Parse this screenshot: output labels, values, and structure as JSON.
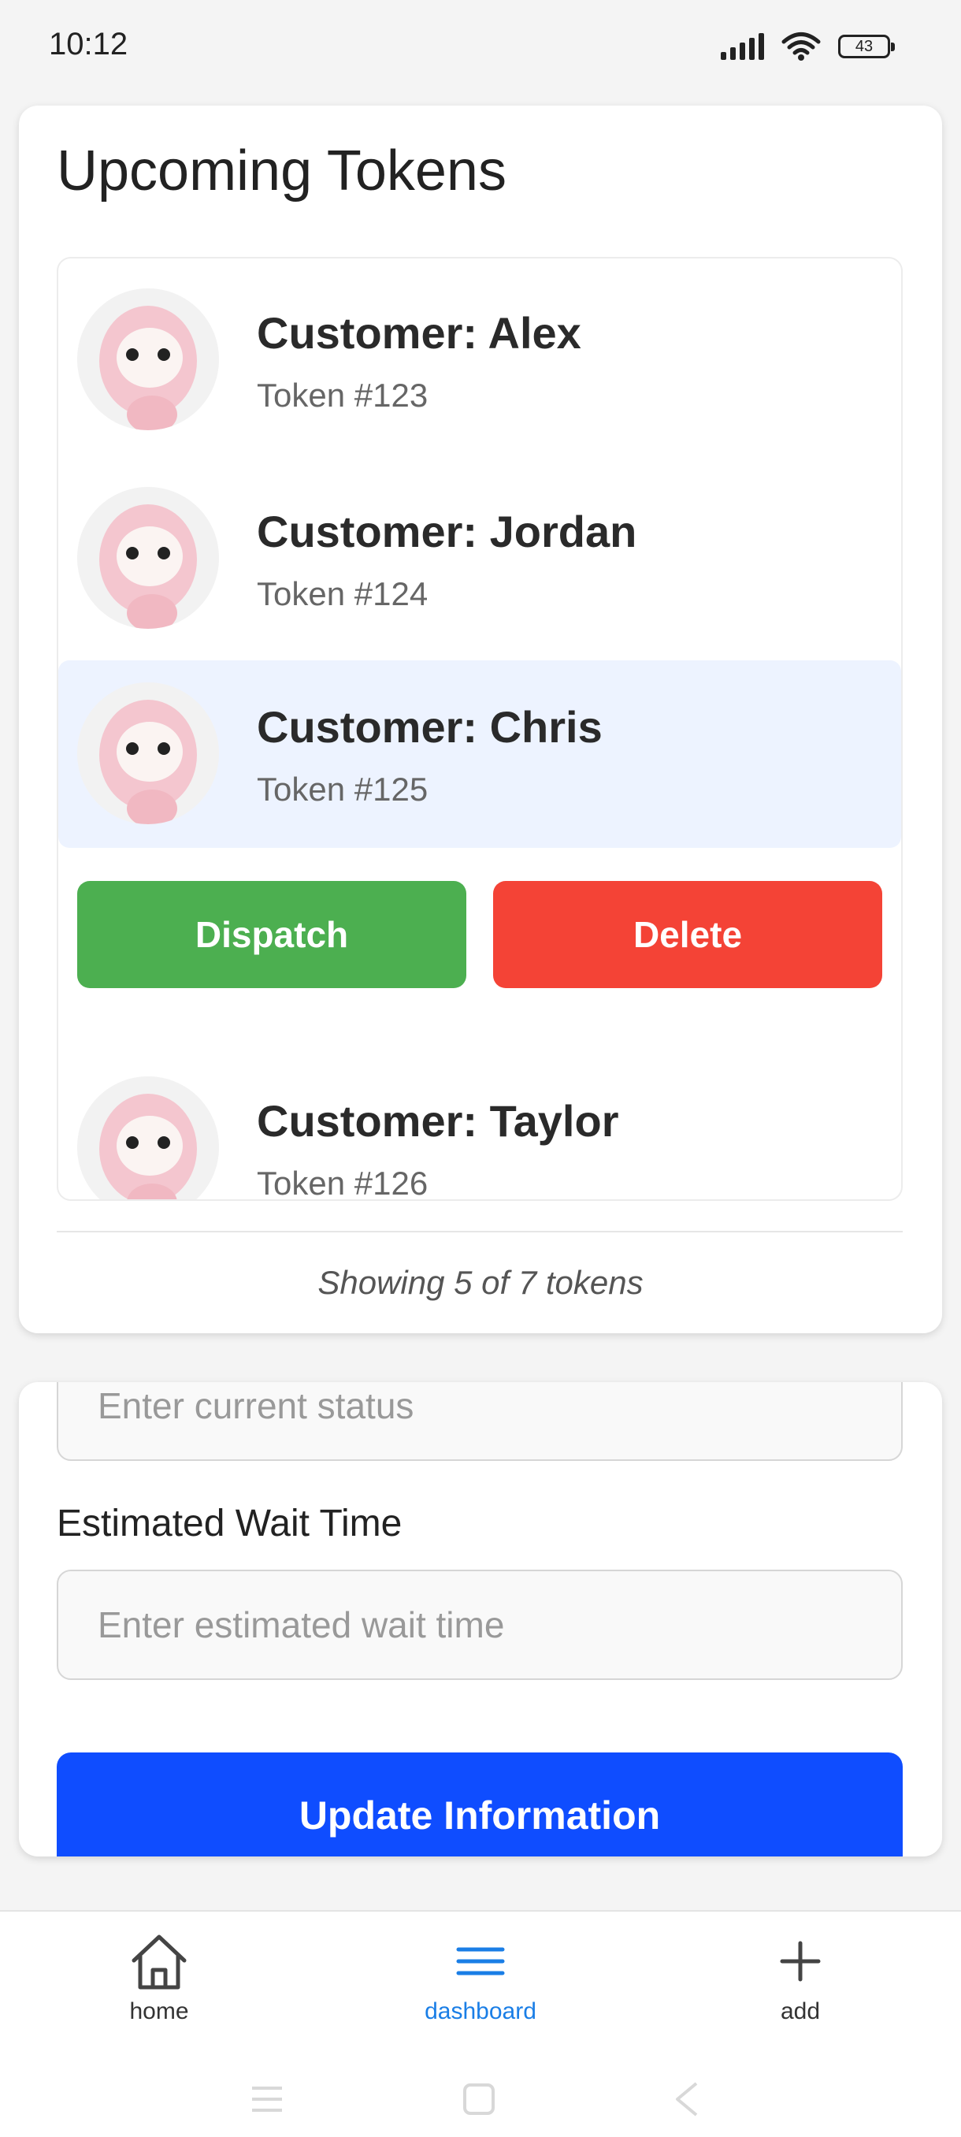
{
  "status_bar": {
    "time": "10:12",
    "battery": "43"
  },
  "tokens_card": {
    "title": "Upcoming Tokens",
    "tokens": [
      {
        "customer": "Customer: Alex",
        "token": "Token #123"
      },
      {
        "customer": "Customer: Jordan",
        "token": "Token #124"
      },
      {
        "customer": "Customer: Chris",
        "token": "Token #125"
      },
      {
        "customer": "Customer: Taylor",
        "token": "Token #126"
      }
    ],
    "actions": {
      "dispatch": "Dispatch",
      "delete": "Delete"
    },
    "footer": "Showing 5 of 7 tokens"
  },
  "form": {
    "status_placeholder": "Enter current status",
    "wait_label": "Estimated Wait Time",
    "wait_placeholder": "Enter estimated wait time",
    "submit": "Update Information"
  },
  "bottom_nav": {
    "items": [
      {
        "label": "home",
        "icon": "home-icon"
      },
      {
        "label": "dashboard",
        "icon": "menu-icon"
      },
      {
        "label": "add",
        "icon": "plus-icon"
      }
    ],
    "active": "dashboard",
    "active_color": "#1a7ee6"
  },
  "colors": {
    "dispatch": "#4caf50",
    "delete": "#f44336",
    "primary": "#0f4dff",
    "selected_row": "#edf3ff"
  }
}
